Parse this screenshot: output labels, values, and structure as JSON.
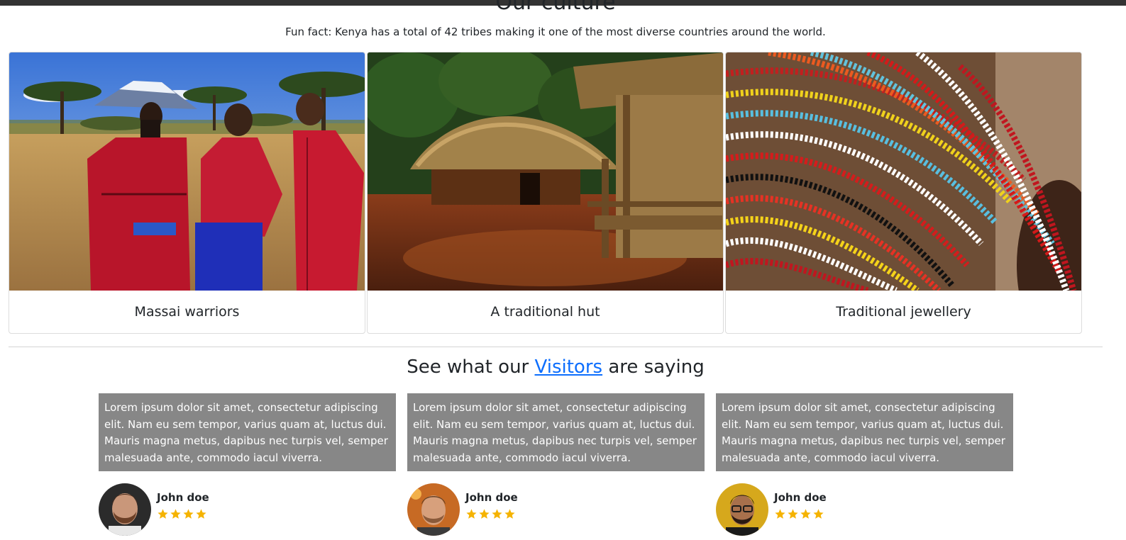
{
  "culture": {
    "title": "Our culture",
    "fun_fact": "Fun fact: Kenya has a total of 42 tribes making it one of the most diverse countries around the world."
  },
  "cards": [
    {
      "caption": "Massai warriors"
    },
    {
      "caption": "A traditional hut"
    },
    {
      "caption": "Traditional jewellery"
    }
  ],
  "visitors": {
    "title_before": "See what our ",
    "title_link": "Visitors",
    "title_after": " are saying",
    "link_color": "#0d6efd"
  },
  "testimonials": [
    {
      "quote": "Lorem ipsum dolor sit amet, consectetur adipiscing elit. Nam eu sem tempor, varius quam at, luctus dui. Mauris magna metus, dapibus nec turpis vel, semper malesuada ante, commodo iacul viverra.",
      "name": "John doe",
      "rating": 4
    },
    {
      "quote": "Lorem ipsum dolor sit amet, consectetur adipiscing elit. Nam eu sem tempor, varius quam at, luctus dui. Mauris magna metus, dapibus nec turpis vel, semper malesuada ante, commodo iacul viverra.",
      "name": "John doe",
      "rating": 4
    },
    {
      "quote": "Lorem ipsum dolor sit amet, consectetur adipiscing elit. Nam eu sem tempor, varius quam at, luctus dui. Mauris magna metus, dapibus nec turpis vel, semper malesuada ante, commodo iacul viverra.",
      "name": "John doe",
      "rating": 4
    }
  ],
  "colors": {
    "quote_bg": "#878787",
    "star": "#f5b300"
  }
}
